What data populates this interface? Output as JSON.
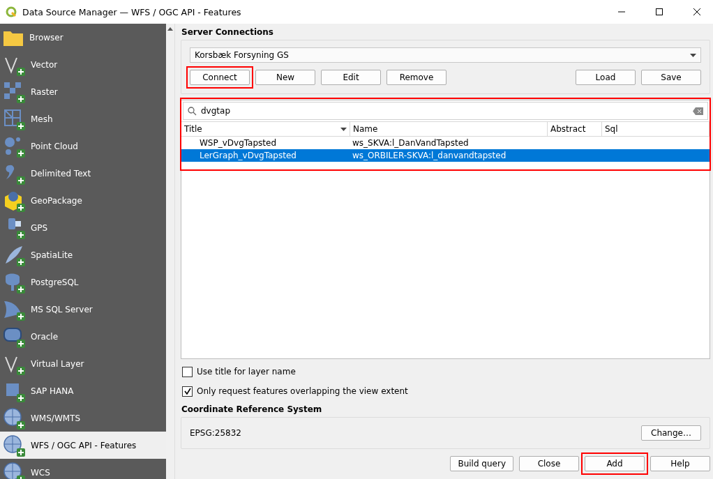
{
  "window": {
    "title": "Data Source Manager — WFS / OGC API - Features"
  },
  "sidebar": {
    "items": [
      {
        "label": "Browser",
        "kind": "folder",
        "selected": false
      },
      {
        "label": "Vector",
        "kind": "vector",
        "selected": false
      },
      {
        "label": "Raster",
        "kind": "raster",
        "selected": false
      },
      {
        "label": "Mesh",
        "kind": "mesh",
        "selected": false
      },
      {
        "label": "Point Cloud",
        "kind": "points",
        "selected": false
      },
      {
        "label": "Delimited Text",
        "kind": "comma",
        "selected": false
      },
      {
        "label": "GeoPackage",
        "kind": "box",
        "selected": false
      },
      {
        "label": "GPS",
        "kind": "device",
        "selected": false
      },
      {
        "label": "SpatiaLite",
        "kind": "feather",
        "selected": false
      },
      {
        "label": "PostgreSQL",
        "kind": "database",
        "selected": false
      },
      {
        "label": "MS SQL Server",
        "kind": "sail",
        "selected": false
      },
      {
        "label": "Oracle",
        "kind": "rounded",
        "selected": false
      },
      {
        "label": "Virtual Layer",
        "kind": "vector",
        "selected": false
      },
      {
        "label": "SAP HANA",
        "kind": "square",
        "selected": false
      },
      {
        "label": "WMS/WMTS",
        "kind": "globe",
        "selected": false
      },
      {
        "label": "WFS / OGC API - Features",
        "kind": "globe",
        "selected": true
      },
      {
        "label": "WCS",
        "kind": "globe",
        "selected": false
      }
    ]
  },
  "server_connections": {
    "title": "Server Connections",
    "connection": "Korsbæk Forsyning GS",
    "buttons": [
      {
        "label": "Connect",
        "highlighted": true
      },
      {
        "label": "New",
        "highlighted": false
      },
      {
        "label": "Edit",
        "highlighted": false
      },
      {
        "label": "Remove",
        "highlighted": false
      }
    ],
    "file_buttons": [
      "Load",
      "Save"
    ]
  },
  "layers": {
    "highlighted": true,
    "search": "dvgtap",
    "columns": [
      "Title",
      "Name",
      "Abstract",
      "Sql"
    ],
    "rows": [
      {
        "cells": [
          "WSP_vDvgTapsted",
          "ws_SKVA:l_DanVandTapsted",
          "",
          ""
        ],
        "selected": false
      },
      {
        "cells": [
          "LerGraph_vDvgTapsted",
          "ws_ORBILER-SKVA:l_danvandtapsted",
          "",
          ""
        ],
        "selected": true
      }
    ]
  },
  "options": [
    {
      "label": "Use title for layer name",
      "checked": false
    },
    {
      "label": "Only request features overlapping the view extent",
      "checked": true
    }
  ],
  "crs": {
    "title": "Coordinate Reference System",
    "value": "EPSG:25832",
    "button": "Change…"
  },
  "footer_buttons": [
    {
      "label": "Build query",
      "highlighted": false
    },
    {
      "label": "Close",
      "highlighted": false
    },
    {
      "label": "Add",
      "highlighted": true
    },
    {
      "label": "Help",
      "highlighted": false
    }
  ]
}
